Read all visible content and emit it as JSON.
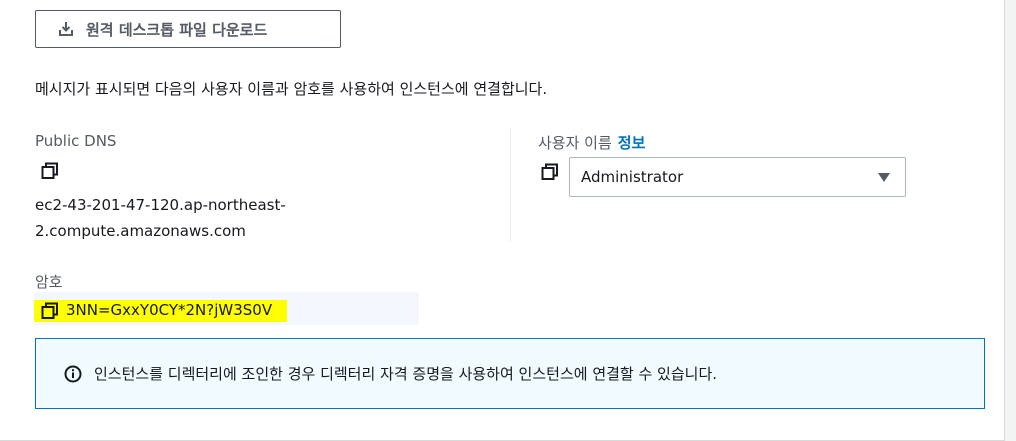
{
  "download": {
    "label": "원격 데스크톱 파일 다운로드",
    "icon": "download-icon"
  },
  "instructions": "메시지가 표시되면 다음의 사용자 이름과 암호를 사용하여 인스턴스에 연결합니다.",
  "dns": {
    "label": "Public DNS",
    "value": "ec2-43-201-47-120.ap-northeast-2.compute.amazonaws.com",
    "line1": "ec2-43-201-47-120.ap-northeast-",
    "line2": "2.compute.amazonaws.com"
  },
  "user": {
    "label": "사용자 이름",
    "info_link": "정보",
    "selected": "Administrator"
  },
  "password": {
    "label": "암호",
    "value": "3NN=GxxY0CY*2N?jW3S0V"
  },
  "alert": {
    "text": "인스턴스를 디렉터리에 조인한 경우 디렉터리 자격 증명을 사용하여 인스턴스에 연결할 수 있습니다."
  },
  "colors": {
    "accent": "#0073bb",
    "highlight": "#ffff00",
    "alert_bg": "#f1faff"
  }
}
